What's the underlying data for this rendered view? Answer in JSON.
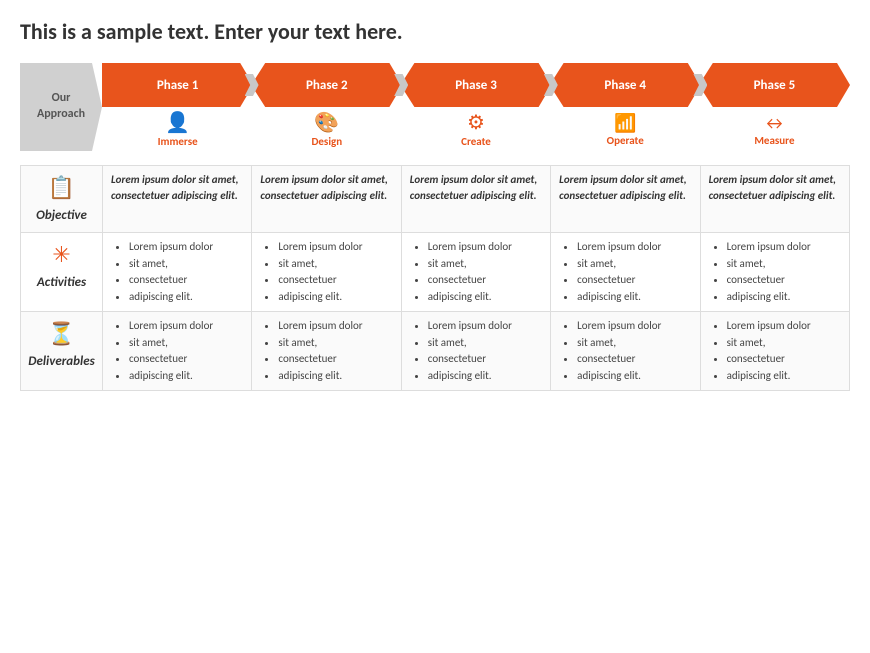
{
  "title": "This is a sample text. Enter your text here.",
  "approach": {
    "label": "Our\nApproach"
  },
  "phases": [
    {
      "id": 1,
      "label": "Phase 1",
      "icon": "👤",
      "sublabel": "Immerse"
    },
    {
      "id": 2,
      "label": "Phase 2",
      "icon": "🎨",
      "sublabel": "Design"
    },
    {
      "id": 3,
      "label": "Phase 3",
      "icon": "⚙",
      "sublabel": "Create"
    },
    {
      "id": 4,
      "label": "Phase 4",
      "icon": "📊",
      "sublabel": "Operate"
    },
    {
      "id": 5,
      "label": "Phase 5",
      "icon": "↔",
      "sublabel": "Measure"
    }
  ],
  "rows": [
    {
      "id": "objective",
      "icon": "📋",
      "label": "Objective",
      "italic": true,
      "cells": [
        "Lorem ipsum dolor sit amet, consectetuer adipiscing elit.",
        "Lorem ipsum dolor sit amet, consectetuer adipiscing elit.",
        "Lorem ipsum dolor sit amet, consectetuer adipiscing elit.",
        "Lorem ipsum dolor sit amet, consectetuer adipiscing elit.",
        "Lorem ipsum dolor sit amet, consectetuer adipiscing elit."
      ]
    },
    {
      "id": "activities",
      "icon": "✳",
      "label": "Activities",
      "italic": false,
      "cells": [
        [
          "Lorem ipsum dolor",
          "sit amet,",
          "consectetuer",
          "adipiscing elit."
        ],
        [
          "Lorem ipsum dolor",
          "sit amet,",
          "consectetuer",
          "adipiscing elit."
        ],
        [
          "Lorem ipsum dolor",
          "sit amet,",
          "consectetuer",
          "adipiscing elit."
        ],
        [
          "Lorem ipsum dolor",
          "sit amet,",
          "consectetuer",
          "adipiscing elit."
        ],
        [
          "Lorem ipsum dolor",
          "sit amet,",
          "consectetuer",
          "adipiscing elit."
        ]
      ]
    },
    {
      "id": "deliverables",
      "icon": "⏳",
      "label": "Deliverables",
      "italic": false,
      "cells": [
        [
          "Lorem ipsum dolor",
          "sit amet,",
          "consectetuer",
          "adipiscing elit."
        ],
        [
          "Lorem ipsum dolor",
          "sit amet,",
          "consectetuer",
          "adipiscing elit."
        ],
        [
          "Lorem ipsum dolor",
          "sit amet,",
          "consectetuer",
          "adipiscing elit."
        ],
        [
          "Lorem ipsum dolor",
          "sit amet,",
          "consectetuer",
          "adipiscing elit."
        ],
        [
          "Lorem ipsum dolor",
          "sit amet,",
          "consectetuer",
          "adipiscing elit."
        ]
      ]
    }
  ],
  "colors": {
    "orange": "#e8541c",
    "gray": "#c8c8c8",
    "text_dark": "#333333"
  }
}
